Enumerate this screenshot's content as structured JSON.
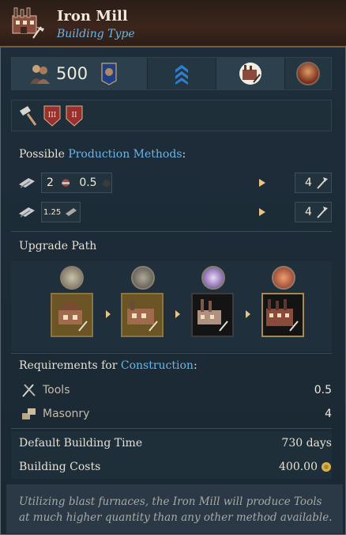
{
  "header": {
    "title": "Iron Mill",
    "subtitle": "Building Type"
  },
  "stats": {
    "workers": "500"
  },
  "production": {
    "heading_prefix": "Possible ",
    "heading_highlight": "Production Methods",
    "heading_suffix": ":",
    "methods": [
      {
        "input_a": "2",
        "input_b": "0.5",
        "output": "4"
      },
      {
        "input_a": "1.25",
        "output": "4"
      }
    ]
  },
  "upgrade": {
    "heading": "Upgrade Path",
    "nodes": [
      "building-1",
      "building-2",
      "building-3",
      "building-4"
    ]
  },
  "requirements": {
    "heading_prefix": "Requirements for ",
    "heading_highlight": "Construction",
    "heading_suffix": ":",
    "items": [
      {
        "name": "Tools",
        "value": "0.5"
      },
      {
        "name": "Masonry",
        "value": "4"
      }
    ]
  },
  "info": {
    "time_label": "Default Building Time",
    "time_value": "730 days",
    "cost_label": "Building Costs",
    "cost_value": "400.00"
  },
  "description": "Utilizing blast furnaces, the Iron Mill will produce Tools at much higher quantity than any other method available.",
  "colors": {
    "accent": "#69b6e6",
    "arrow": "#e9c681",
    "gold": "#d7b34a"
  }
}
